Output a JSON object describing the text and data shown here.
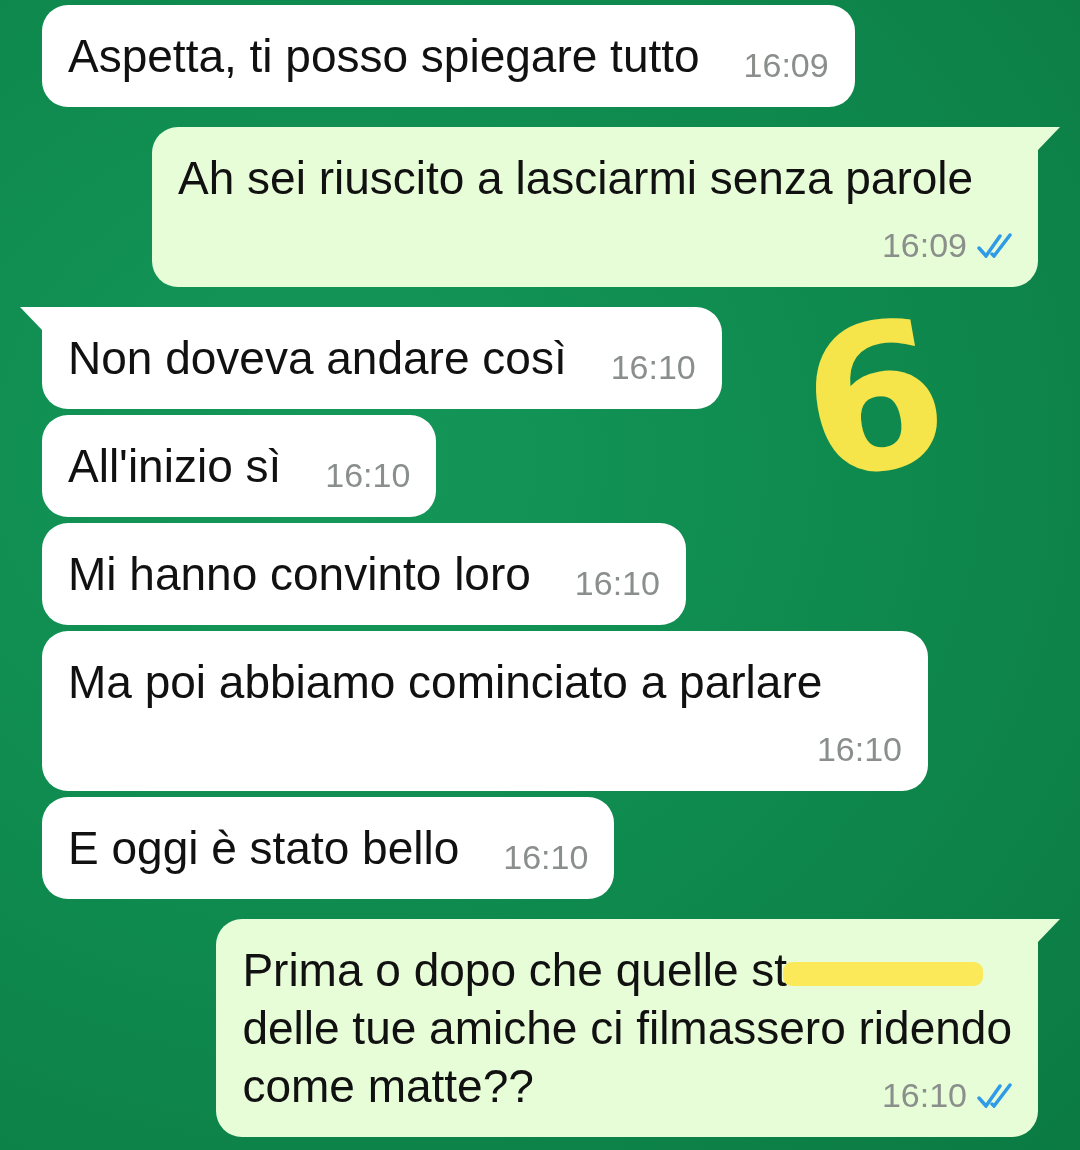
{
  "messages": [
    {
      "kind": "received",
      "tail": false,
      "lines": [
        "Aspetta, ti posso spiegare tutto"
      ],
      "time": "16:09"
    },
    {
      "kind": "sent",
      "tail": true,
      "lines": [
        "Ah sei riuscito a lasciarmi senza parole"
      ],
      "time": "16:09",
      "read": true
    },
    {
      "kind": "received",
      "tail": true,
      "lines": [
        "Non doveva andare così"
      ],
      "time": "16:10"
    },
    {
      "kind": "received",
      "tail": false,
      "lines": [
        "All'inizio sì"
      ],
      "time": "16:10"
    },
    {
      "kind": "received",
      "tail": false,
      "lines": [
        "Mi hanno convinto loro"
      ],
      "time": "16:10"
    },
    {
      "kind": "received",
      "tail": false,
      "lines": [
        "Ma poi abbiamo cominciato a parlare"
      ],
      "time": "16:10"
    },
    {
      "kind": "received",
      "tail": false,
      "lines": [
        "E oggi è stato bello"
      ],
      "time": "16:10"
    },
    {
      "kind": "sent",
      "tail": true,
      "lines": [
        "Prima o dopo che quelle st",
        "delle tue amiche ci filmassero ridendo",
        "come matte??"
      ],
      "redacted": true,
      "time": "16:10",
      "read": true
    }
  ],
  "annotation": {
    "text": "6"
  }
}
